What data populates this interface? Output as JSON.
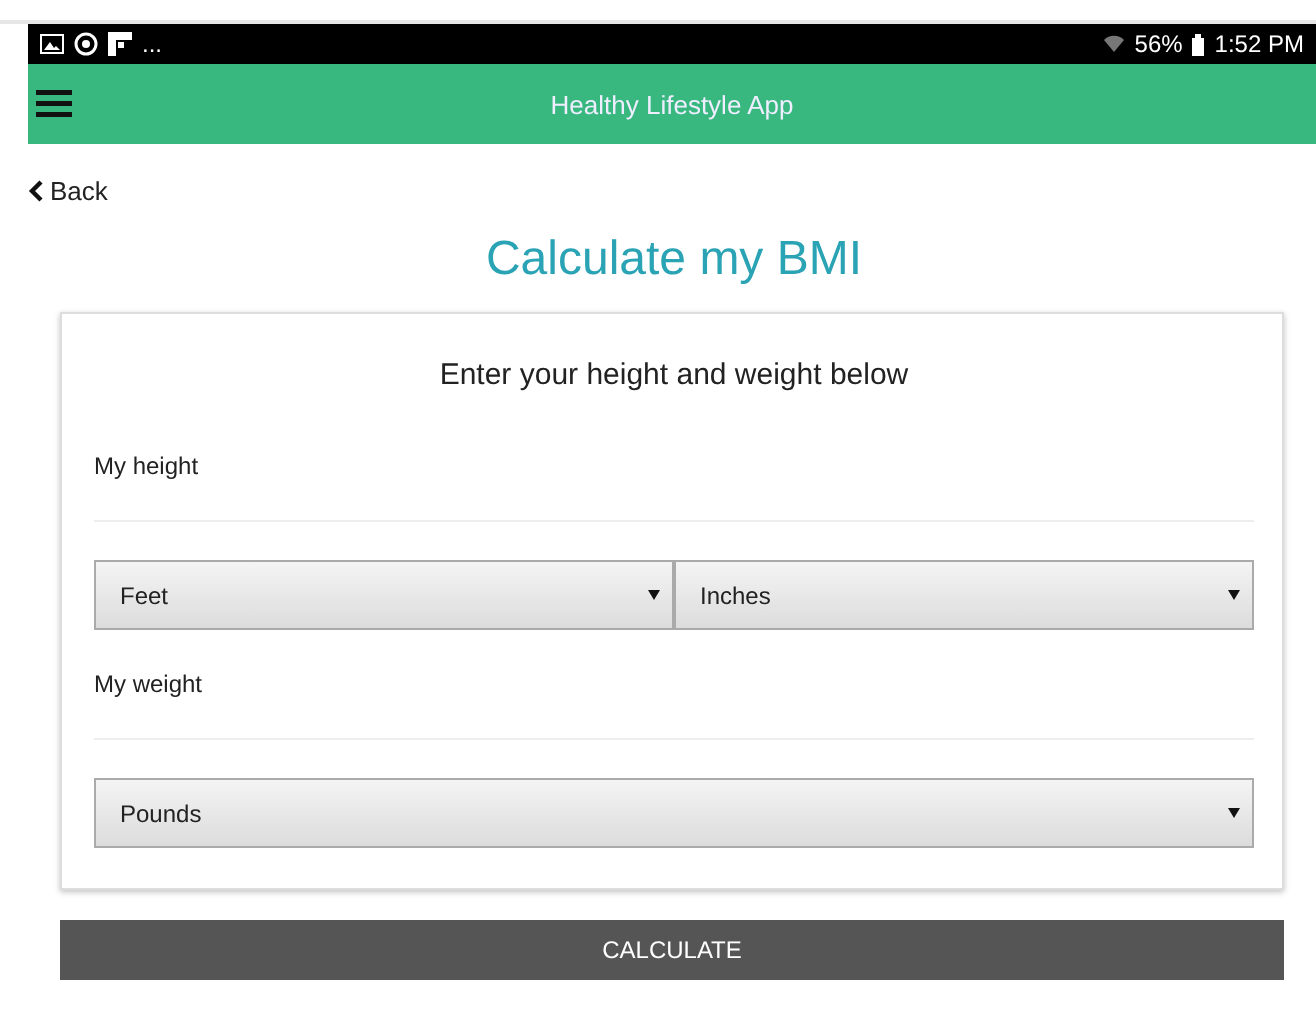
{
  "status_bar": {
    "overflow": "...",
    "battery": "56%",
    "time": "1:52 PM"
  },
  "app_bar": {
    "title": "Healthy Lifestyle App"
  },
  "back": "Back",
  "title": "Calculate my BMI",
  "card": {
    "heading": "Enter your height and weight below",
    "sections": [
      {
        "label": "My height",
        "selects": [
          "Feet",
          "Inches"
        ]
      },
      {
        "label": "My weight",
        "selects": [
          "Pounds"
        ]
      }
    ]
  },
  "button": "CALCULATE"
}
